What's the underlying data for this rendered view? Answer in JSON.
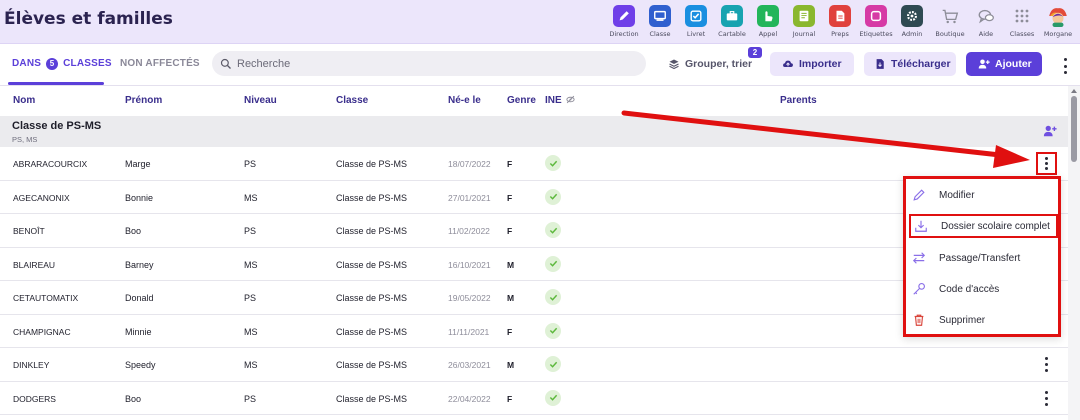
{
  "header": {
    "title": "Élèves et familles",
    "nav": [
      {
        "label": "Direction",
        "icon": "pencil-icon",
        "color": "#6f3fe8"
      },
      {
        "label": "Classe",
        "icon": "board-icon",
        "color": "#2f5fcf"
      },
      {
        "label": "Livret",
        "icon": "checkbox-icon",
        "color": "#1a8fe0"
      },
      {
        "label": "Cartable",
        "icon": "briefcase-icon",
        "color": "#17a3b0"
      },
      {
        "label": "Appel",
        "icon": "hand-icon",
        "color": "#23b55a"
      },
      {
        "label": "Journal",
        "icon": "journal-icon",
        "color": "#8ab72e"
      },
      {
        "label": "Preps",
        "icon": "document-icon",
        "color": "#e0413d"
      },
      {
        "label": "Etiquettes",
        "icon": "label-icon",
        "color": "#d63aa5"
      },
      {
        "label": "Admin",
        "icon": "gear-icon",
        "color": "#2f4a52"
      },
      {
        "label": "Boutique",
        "icon": "cart-icon",
        "color": "#8d8d98"
      },
      {
        "label": "Aide",
        "icon": "chat-icon",
        "color": "#8d8d98"
      },
      {
        "label": "Classes",
        "icon": "grid-icon",
        "color": "#8d8d98"
      },
      {
        "label": "Morgane",
        "icon": "avatar-icon",
        "color": "#e34b3a"
      }
    ]
  },
  "toolbar": {
    "tab_active_prefix": "DANS",
    "tab_active_count": "5",
    "tab_active_suffix": "CLASSES",
    "tab_inactive": "NON AFFECTÉS",
    "search_placeholder": "Recherche",
    "group_label": "Grouper, trier",
    "group_badge": "2",
    "import_label": "Importer",
    "download_label": "Télécharger",
    "add_label": "Ajouter"
  },
  "table": {
    "columns": {
      "nom": "Nom",
      "prenom": "Prénom",
      "niveau": "Niveau",
      "classe": "Classe",
      "nele": "Né-e le",
      "genre": "Genre",
      "ine": "INE",
      "parents": "Parents"
    },
    "group": {
      "title": "Classe de PS-MS",
      "subtitle": "PS, MS"
    },
    "rows": [
      {
        "nom": "ABRARACOURCIX",
        "prenom": "Marge",
        "niveau": "PS",
        "classe": "Classe de PS-MS",
        "date": "18/07/2022",
        "genre": "F"
      },
      {
        "nom": "AGECANONIX",
        "prenom": "Bonnie",
        "niveau": "MS",
        "classe": "Classe de PS-MS",
        "date": "27/01/2021",
        "genre": "F"
      },
      {
        "nom": "BENOÎT",
        "prenom": "Boo",
        "niveau": "PS",
        "classe": "Classe de PS-MS",
        "date": "11/02/2022",
        "genre": "F"
      },
      {
        "nom": "BLAIREAU",
        "prenom": "Barney",
        "niveau": "MS",
        "classe": "Classe de PS-MS",
        "date": "16/10/2021",
        "genre": "M"
      },
      {
        "nom": "CETAUTOMATIX",
        "prenom": "Donald",
        "niveau": "PS",
        "classe": "Classe de PS-MS",
        "date": "19/05/2022",
        "genre": "M"
      },
      {
        "nom": "CHAMPIGNAC",
        "prenom": "Minnie",
        "niveau": "MS",
        "classe": "Classe de PS-MS",
        "date": "11/11/2021",
        "genre": "F"
      },
      {
        "nom": "DINKLEY",
        "prenom": "Speedy",
        "niveau": "MS",
        "classe": "Classe de PS-MS",
        "date": "26/03/2021",
        "genre": "M"
      },
      {
        "nom": "DODGERS",
        "prenom": "Boo",
        "niveau": "PS",
        "classe": "Classe de PS-MS",
        "date": "22/04/2022",
        "genre": "F"
      }
    ]
  },
  "context_menu": {
    "items": [
      {
        "label": "Modifier",
        "icon": "pencil-icon"
      },
      {
        "label": "Dossier scolaire complet",
        "icon": "download-icon"
      },
      {
        "label": "Passage/Transfert",
        "icon": "transfer-icon"
      },
      {
        "label": "Code d'accès",
        "icon": "key-icon"
      },
      {
        "label": "Supprimer",
        "icon": "trash-icon"
      }
    ]
  },
  "colors": {
    "accent": "#5b3fd9",
    "highlight": "#e01010",
    "check_bg": "#dff1d6",
    "check": "#5cb83c"
  }
}
